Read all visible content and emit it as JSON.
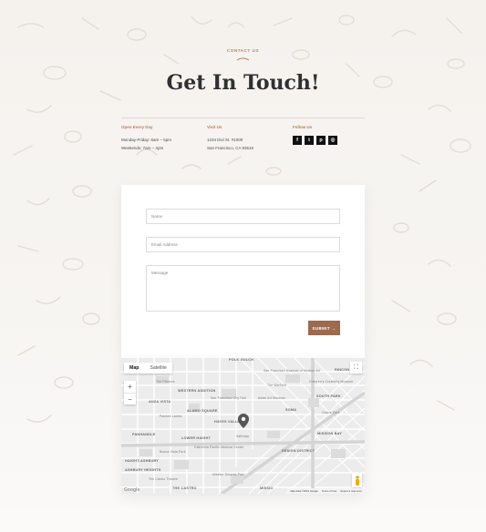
{
  "header": {
    "eyebrow": "CONTACT US",
    "title": "Get In Touch!"
  },
  "info": {
    "hours": {
      "heading": "Open Every Day",
      "lines": [
        "Monday-Friday: 6am – 5pm",
        "Weekends: 7am – 4pm"
      ]
    },
    "visit": {
      "heading": "Visit Us",
      "lines": [
        "1234 Divi St. #1000",
        "San Francisco, CA 93515"
      ]
    },
    "follow": {
      "heading": "Follow Us",
      "icons": [
        {
          "name": "facebook-icon",
          "glyph": "f"
        },
        {
          "name": "twitter-icon",
          "glyph": "t"
        },
        {
          "name": "pinterest-icon",
          "glyph": "p"
        },
        {
          "name": "instagram-icon",
          "glyph": "◎"
        }
      ]
    }
  },
  "form": {
    "name_placeholder": "Name",
    "email_placeholder": "Email Address",
    "message_placeholder": "Message",
    "submit_label": "SUBMIT →"
  },
  "map": {
    "type_map": "Map",
    "type_satellite": "Satellite",
    "zoom_in": "+",
    "zoom_out": "−",
    "fullscreen": "⛶",
    "google": "Google",
    "labels": {
      "polk_gulch": "POLK GULCH",
      "rincon_hill": "RINCON H",
      "western_addition": "WESTERN ADDITION",
      "alamo_square": "ALAMO SQUARE",
      "anza_vista": "ANZA VISTA",
      "hayes_valley": "HAYES VALLEY",
      "soma": "SOMA",
      "south_park": "SOUTH PARK",
      "mission_bay": "MISSION BAY",
      "lower_haight": "LOWER HAIGHT",
      "panhandle": "PANHANDLE",
      "haight_ashbury": "HAIGHT-ASHBURY",
      "ashbury_heights": "ASHBURY HEIGHTS",
      "design_district": "DESIGN DISTRICT",
      "mission": "MISSIO",
      "castro": "THE CASTRO",
      "sf_museum": "San Francisco Museum of Modern Art",
      "city_hall": "San Francisco City Hall",
      "asian_art": "Asian Art Museum",
      "childrens_museum": "Children's Creativity Museum",
      "the_fillmore": "The Fillmore",
      "painted_ladies": "Painted Ladies",
      "warfield": "The Warfield",
      "oracle_park": "Oracle Park",
      "cal_prep": "California Pacific Medical Center",
      "dolores": "Mission Dolores Park",
      "safeway": "Safeway",
      "buena_vista": "Buena Vista Park",
      "twin_peaks": "The Castro Theatre"
    },
    "attribution": [
      "Map data ©2019 Google",
      "Terms of Use",
      "Report a map error"
    ]
  },
  "colors": {
    "accent": "#b5825f",
    "button": "#9c6a4e",
    "title": "#2f3033"
  }
}
